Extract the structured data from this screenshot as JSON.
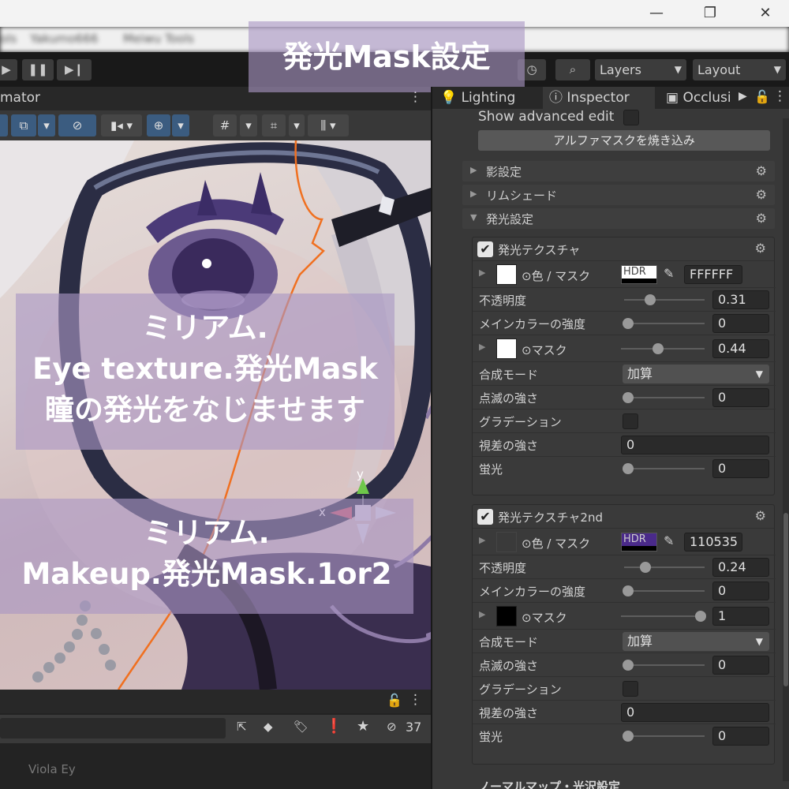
{
  "window": {
    "close_glyph": "✕",
    "restore_glyph": "❐",
    "minimize_glyph": "—"
  },
  "menubar": {
    "items": [
      "ols",
      "Yakumo666",
      "Meiwu Tools"
    ]
  },
  "toolbar": {
    "layers_label": "Layers",
    "layout_label": "Layout"
  },
  "scene": {
    "tab_label": "mator",
    "gizmo_y": "y",
    "gizmo_x": "x",
    "bottom_count": "37",
    "bottom_item": "Viola Ey"
  },
  "overlays": {
    "title": "発光Mask設定",
    "eye_line1": "ミリアム.",
    "eye_line2": "Eye texture.発光Mask",
    "eye_line3": "瞳の発光をなじませます",
    "makeup_line1": "ミリアム.",
    "makeup_line2": "Makeup.発光Mask.1or2"
  },
  "inspector": {
    "tabs": {
      "lighting": "Lighting",
      "inspector": "Inspector",
      "occlusion": "Occlusi"
    },
    "show_advanced": "Show advanced edit",
    "bake_alpha_button": "アルファマスクを焼き込み",
    "sections": {
      "shadow": "影設定",
      "rim": "リムシェード",
      "emission": "発光設定"
    },
    "emission1": {
      "header": "発光テクスチャ",
      "color_mask_label": "色 / マスク",
      "hdr_label": "HDR",
      "color_hex": "FFFFFF",
      "opacity_label": "不透明度",
      "opacity_value": "0.31",
      "main_strength_label": "メインカラーの強度",
      "main_strength_value": "0",
      "mask_label": "マスク",
      "mask_value": "0.44",
      "blend_label": "合成モード",
      "blend_value": "加算",
      "blink_label": "点滅の強さ",
      "blink_value": "0",
      "gradation_label": "グラデーション",
      "parallax_label": "視差の強さ",
      "parallax_value": "0",
      "firefly_label": "蛍光",
      "firefly_value": "0"
    },
    "emission2": {
      "header": "発光テクスチャ2nd",
      "color_mask_label": "色 / マスク",
      "hdr_label": "HDR",
      "color_hex": "110535",
      "opacity_label": "不透明度",
      "opacity_value": "0.24",
      "main_strength_label": "メインカラーの強度",
      "main_strength_value": "0",
      "mask_label": "マスク",
      "mask_value": "1",
      "blend_label": "合成モード",
      "blend_value": "加算",
      "blink_label": "点滅の強さ",
      "blink_value": "0",
      "gradation_label": "グラデーション",
      "parallax_label": "視差の強さ",
      "parallax_value": "0",
      "firefly_label": "蛍光",
      "firefly_value": "0"
    },
    "next_section": "ノーマルマップ・光沢設定"
  },
  "colors": {
    "accent_blue": "#3b5c80",
    "overlay": "#aa96c3",
    "emission2_color": "#110535"
  }
}
